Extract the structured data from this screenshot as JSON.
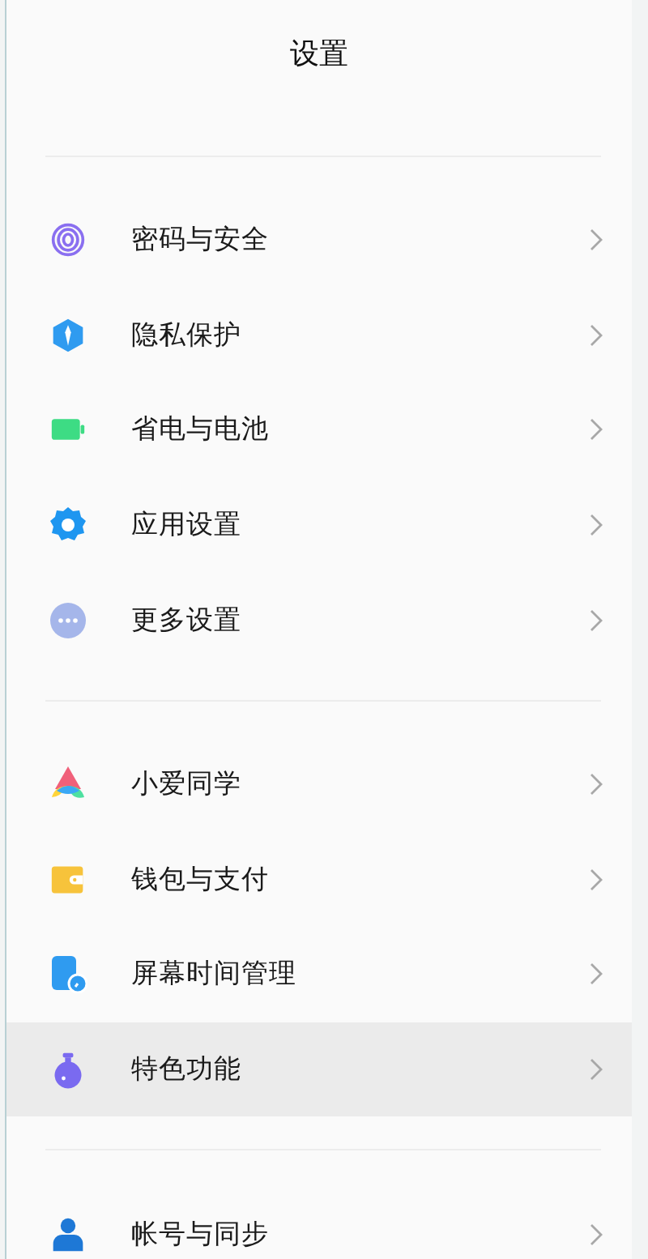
{
  "title": "设置",
  "groups": [
    {
      "items": [
        {
          "kind": "fingerprint",
          "label": "密码与安全",
          "selected": false
        },
        {
          "kind": "shield",
          "label": "隐私保护",
          "selected": false
        },
        {
          "kind": "battery",
          "label": "省电与电池",
          "selected": false
        },
        {
          "kind": "gear",
          "label": "应用设置",
          "selected": false
        },
        {
          "kind": "more",
          "label": "更多设置",
          "selected": false
        }
      ]
    },
    {
      "items": [
        {
          "kind": "assistant",
          "label": "小爱同学",
          "selected": false
        },
        {
          "kind": "wallet",
          "label": "钱包与支付",
          "selected": false
        },
        {
          "kind": "screentime",
          "label": "屏幕时间管理",
          "selected": false
        },
        {
          "kind": "flask",
          "label": "特色功能",
          "selected": true
        }
      ]
    },
    {
      "items": [
        {
          "kind": "person",
          "label": "帐号与同步",
          "selected": false
        }
      ]
    }
  ]
}
